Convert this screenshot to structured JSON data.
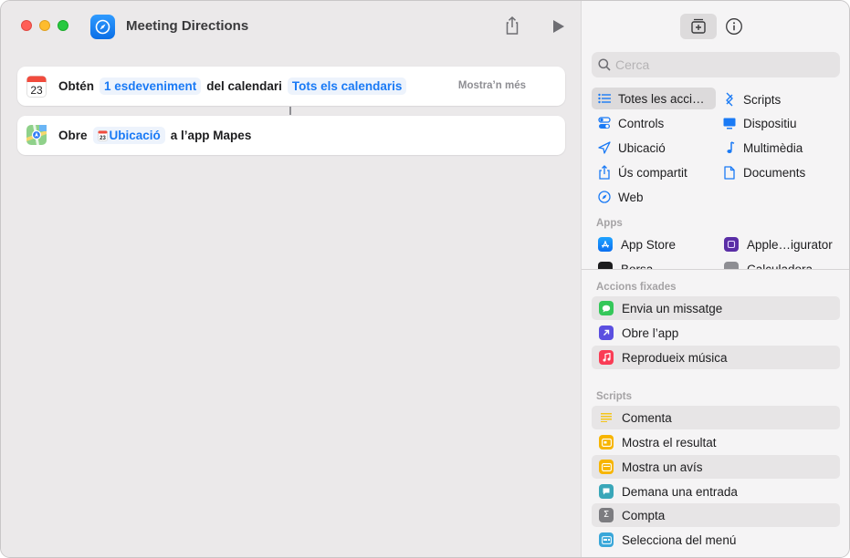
{
  "window": {
    "title": "Meeting Directions"
  },
  "actions": [
    {
      "verb": "Obtén",
      "token1": "1 esdeveniment",
      "middle": "del calendari",
      "token2": "Tots els calendaris",
      "more": "Mostra’n més",
      "icon_day": "23",
      "icon_month": "JUL"
    },
    {
      "verb": "Obre",
      "token": "Ubicació",
      "token_icon_day": "23",
      "rest": "a l’app Mapes"
    }
  ],
  "library": {
    "search_placeholder": "Cerca",
    "categories_left": [
      "Totes les acci…",
      "Controls",
      "Ubicació",
      "Ús compartit",
      "Web"
    ],
    "categories_right": [
      "Scripts",
      "Dispositiu",
      "Multimèdia",
      "Documents"
    ],
    "apps_label": "Apps",
    "apps": [
      "App Store",
      "Apple…igurator",
      "Borsa",
      "Calculadora"
    ],
    "pinned_label": "Accions fixades",
    "pinned": [
      "Envia un missatge",
      "Obre l’app",
      "Reprodueix música"
    ],
    "scripts_label": "Scripts",
    "scripts": [
      "Comenta",
      "Mostra el resultat",
      "Mostra un avís",
      "Demana una entrada",
      "Compta",
      "Selecciona del menú"
    ]
  },
  "colors": {
    "accent": "#1a7af5",
    "close": "#ff5f57",
    "minimize": "#febc2e",
    "zoom": "#28c840"
  }
}
